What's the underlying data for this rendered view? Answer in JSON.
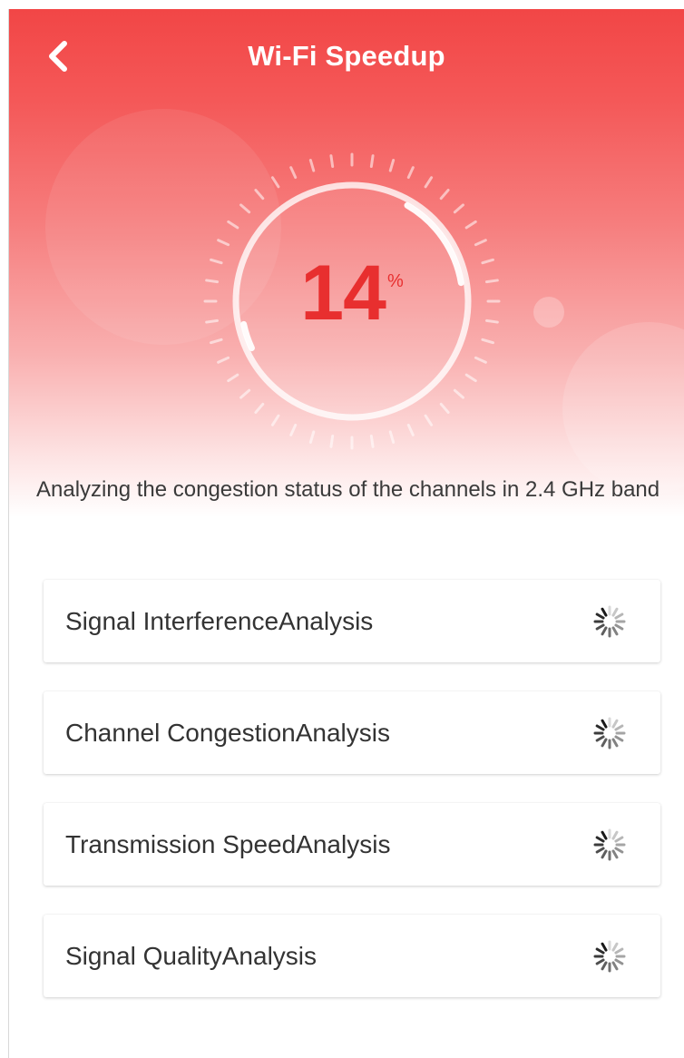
{
  "header": {
    "title": "Wi-Fi Speedup",
    "back_icon": "chevron-left-icon"
  },
  "progress": {
    "value": "14",
    "unit": "%",
    "fraction": 0.14
  },
  "status": {
    "text": "Analyzing the congestion status of the channels in 2.4 GHz band"
  },
  "analysis_items": [
    {
      "label": "Signal InterferenceAnalysis",
      "state": "loading",
      "icon": "loading-spinner-icon"
    },
    {
      "label": "Channel CongestionAnalysis",
      "state": "loading",
      "icon": "loading-spinner-icon"
    },
    {
      "label": "Transmission SpeedAnalysis",
      "state": "loading",
      "icon": "loading-spinner-icon"
    },
    {
      "label": "Signal QualityAnalysis",
      "state": "loading",
      "icon": "loading-spinner-icon"
    }
  ],
  "colors": {
    "accent": "#f24646",
    "percent_text": "#e82f2f",
    "card_text": "#333333"
  }
}
